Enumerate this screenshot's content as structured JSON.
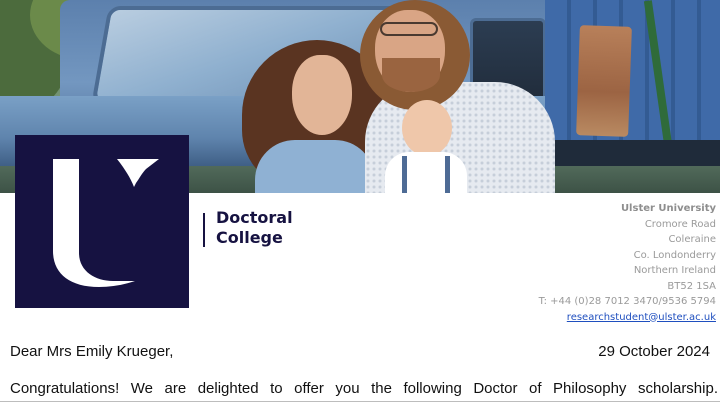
{
  "header": {
    "photo_icon": "family-photo",
    "logo_icon": "ulster-university-u-logo",
    "brand_color": "#161241",
    "department": {
      "line1": "Doctoral",
      "line2": "College"
    }
  },
  "address": {
    "organisation": "Ulster University",
    "street": "Cromore Road",
    "town": "Coleraine",
    "county": "Co. Londonderry",
    "region": "Northern Ireland",
    "postcode": "BT52 1SA",
    "telephone": "T: +44 (0)28 7012 3470/9536 5794",
    "email": "researchstudent@ulster.ac.uk",
    "link_color": "#1f4fbf"
  },
  "letter": {
    "salutation": "Dear Mrs Emily Krueger,",
    "date": "29 October 2024",
    "opening": "Congratulations! We are delighted to offer you the following Doctor of Philosophy scholarship."
  }
}
